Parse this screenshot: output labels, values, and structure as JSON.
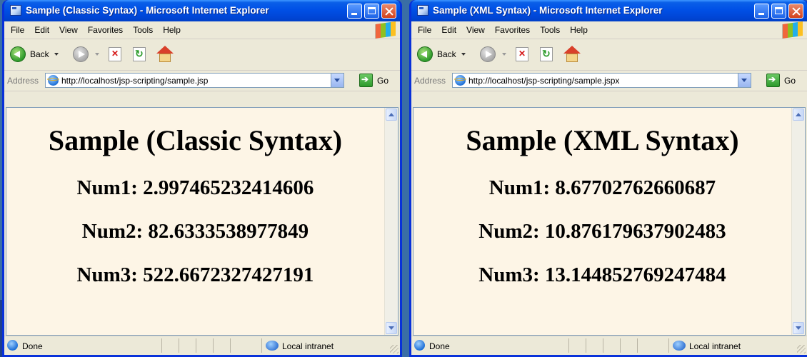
{
  "windows": [
    {
      "title": "Sample (Classic Syntax) - Microsoft Internet Explorer",
      "menu": [
        "File",
        "Edit",
        "View",
        "Favorites",
        "Tools",
        "Help"
      ],
      "toolbar": {
        "back_label": "Back"
      },
      "address": {
        "label": "Address",
        "url": "http://localhost/jsp-scripting/sample.jsp",
        "go_label": "Go"
      },
      "page": {
        "heading": "Sample (Classic Syntax)",
        "lines": [
          "Num1: 2.997465232414606",
          "Num2: 82.6333538977849",
          "Num3: 522.6672327427191"
        ]
      },
      "status": {
        "text": "Done",
        "zone": "Local intranet"
      }
    },
    {
      "title": "Sample (XML Syntax) - Microsoft Internet Explorer",
      "menu": [
        "File",
        "Edit",
        "View",
        "Favorites",
        "Tools",
        "Help"
      ],
      "toolbar": {
        "back_label": "Back"
      },
      "address": {
        "label": "Address",
        "url": "http://localhost/jsp-scripting/sample.jspx",
        "go_label": "Go"
      },
      "page": {
        "heading": "Sample (XML Syntax)",
        "lines": [
          "Num1: 8.67702762660687",
          "Num2: 10.876179637902483",
          "Num3: 13.144852769247484"
        ]
      },
      "status": {
        "text": "Done",
        "zone": "Local intranet"
      }
    }
  ],
  "colors": {
    "page_background": "#fdf5e6",
    "titlebar": "#0050e6",
    "chrome": "#ece9d8"
  }
}
